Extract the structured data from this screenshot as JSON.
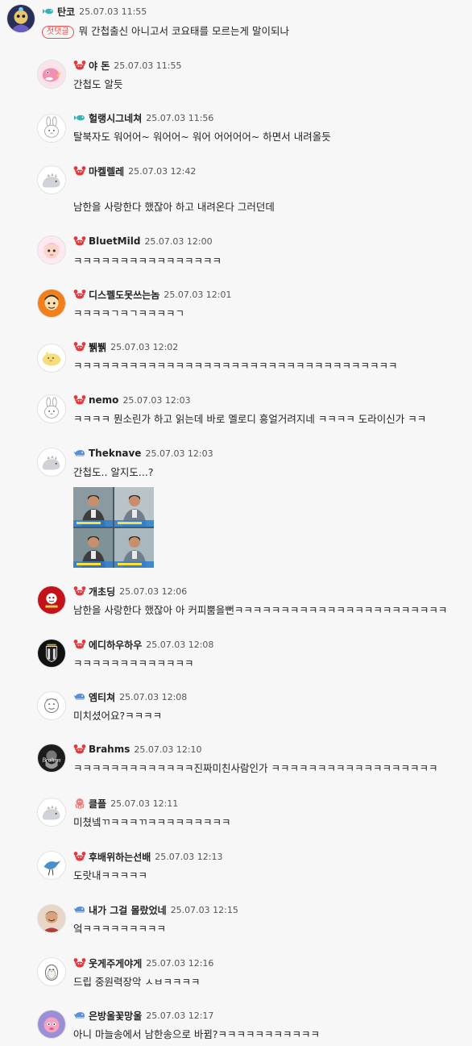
{
  "first_comment_tag": "첫댓글",
  "comments": [
    {
      "nick": "탄코",
      "time": "25.07.03 11:55",
      "text": "뭐 간첩출신 아니고서 코요태를 모르는게 말이되나",
      "badge": "fish-icon",
      "avatar": "character-avatar"
    },
    {
      "nick": "야 돈",
      "time": "25.07.03 11:55",
      "text": "간첩도 알듯",
      "badge": "crab-icon",
      "avatar": "pink-bird-avatar"
    },
    {
      "nick": "헐랭시그네쳐",
      "time": "25.07.03 11:56",
      "text": "탈북자도 워어어~ 워어어~ 워어 어어어어~ 하면서 내려올듯",
      "badge": "fish-icon",
      "avatar": "bunny-avatar"
    },
    {
      "nick": "마켈렐레",
      "time": "25.07.03 12:42",
      "text": "남한을 사랑한다 했잖아 하고 내려온다 그러던데",
      "badge": "crab-icon",
      "avatar": "dino-avatar"
    },
    {
      "nick": "BluetMild",
      "time": "25.07.03 12:00",
      "text": "ㅋㅋㅋㅋㅋㅋㅋㅋㅋㅋㅋㅋㅋㅋㅋㅋ",
      "badge": "crab-icon",
      "avatar": "doll-avatar"
    },
    {
      "nick": "디스펠도못쓰는놈",
      "time": "25.07.03 12:01",
      "text": "ㅋㅋㅋㅋㄱㅋㄱㅋㅋㅋㅋㄱ",
      "badge": "crab-icon",
      "avatar": "cartoon-avatar"
    },
    {
      "nick": "뷁뷁",
      "time": "25.07.03 12:02",
      "text": "ㅋㅋㅋㅋㅋㅋㅋㅋㅋㅋㅋㅋㅋㅋㅋㅋㅋㅋㅋㅋㅋㅋㅋㅋㅋㅋㅋㅋㅋㅋㅋㅋㅋㅋㅋ",
      "badge": "crab-icon",
      "avatar": "chick-avatar"
    },
    {
      "nick": "nemo",
      "time": "25.07.03 12:03",
      "text": "ㅋㅋㅋㅋ 뭔소린가 하고 읽는데 바로 멜로디 흥얼거려지네 ㅋㅋㅋㅋ 도라이신가 ㅋㅋ",
      "badge": "crab-icon",
      "avatar": "bunny-avatar"
    },
    {
      "nick": "Theknave",
      "time": "25.07.03 12:03",
      "text": "간첩도.. 알지도...?",
      "badge": "whale-icon",
      "avatar": "dino-avatar",
      "has_image": true
    },
    {
      "nick": "개초딩",
      "time": "25.07.03 12:06",
      "text": "남한을 사랑한다 했잖아 아 커피뿜을뻔ㅋㅋㅋㅋㅋㅋㅋㅋㅋㅋㅋㅋㅋㅋㅋㅋㅋㅋㅋㅋㅋㅋㅋ",
      "badge": "crab-icon",
      "avatar": "red-logo-avatar"
    },
    {
      "nick": "에디하우하우",
      "time": "25.07.03 12:08",
      "text": "ㅋㅋㅋㅋㅋㅋㅋㅋㅋㅋㅋㅋㅋ",
      "badge": "crab-icon",
      "avatar": "club-crest-avatar"
    },
    {
      "nick": "엠티쳐",
      "time": "25.07.03 12:08",
      "text": "미치셨어요?ㅋㅋㅋㅋ",
      "badge": "whale-icon",
      "avatar": "sketch-avatar"
    },
    {
      "nick": "Brahms",
      "time": "25.07.03 12:10",
      "text": "ㅋㅋㅋㅋㅋㅋㅋㅋㅋㅋㅋㅋㅋ진짜미친사람인가 ㅋㅋㅋㅋㅋㅋㅋㅋㅋㅋㅋㅋㅋㅋㅋㅋㅋㅋ",
      "badge": "crab-icon",
      "avatar": "brahms-avatar"
    },
    {
      "nick": "클플",
      "time": "25.07.03 12:11",
      "text": "미쳤넼ㄲㅋㅋㅋㄲㅋㅋㅋㅋㅋㅋㅋㅋㅋ",
      "badge": "octopus-icon",
      "avatar": "dino-avatar"
    },
    {
      "nick": "후배위하는선배",
      "time": "25.07.03 12:13",
      "text": "도랏내ㅋㅋㅋㅋㅋ",
      "badge": "crab-icon",
      "avatar": "bird-sketch-avatar"
    },
    {
      "nick": "내가 그걸 몰랐었네",
      "time": "25.07.03 12:15",
      "text": "엌ㅋㅋㅋㅋㅋㅋㅋㅋㅋ",
      "badge": "whale-icon",
      "avatar": "person-avatar"
    },
    {
      "nick": "웃게주게야게",
      "time": "25.07.03 12:16",
      "text": "드립 중원력장악 ㅅㅂㅋㅋㅋㅋ",
      "badge": "crab-icon",
      "avatar": "penguin-avatar"
    },
    {
      "nick": "은방울꽃망울",
      "time": "25.07.03 12:17",
      "text": "아니 마늘송에서 남한송으로 바뀜?ㅋㅋㅋㅋㅋㅋㅋㅋㅋㅋㅋ",
      "badge": "whale-icon",
      "avatar": "pink-char-avatar"
    }
  ]
}
